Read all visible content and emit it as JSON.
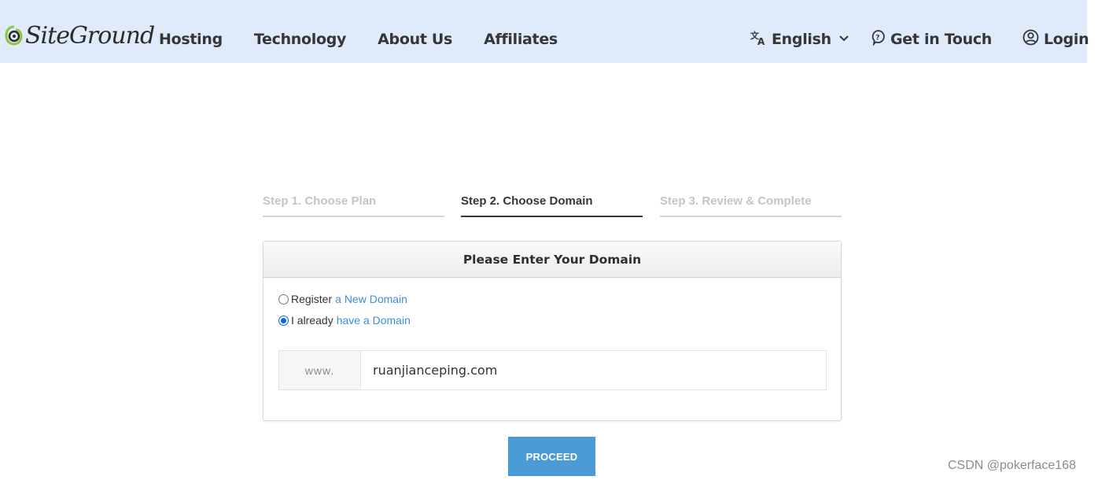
{
  "header": {
    "logo_text": "SiteGround",
    "nav": [
      "Hosting",
      "Technology",
      "About Us",
      "Affiliates"
    ],
    "language": "English",
    "contact": "Get in Touch",
    "login": "Login"
  },
  "steps": [
    {
      "label": "Step 1. Choose Plan",
      "state": "inactive"
    },
    {
      "label": "Step 2. Choose Domain",
      "state": "active"
    },
    {
      "label": "Step 3. Review & Complete",
      "state": "inactive"
    }
  ],
  "card": {
    "title": "Please Enter Your Domain",
    "options": [
      {
        "prefix": "Register",
        "link": "a New Domain",
        "checked": false
      },
      {
        "prefix": "I already",
        "link": "have a Domain",
        "checked": true
      }
    ],
    "domain_prefix": "www.",
    "domain_value": "ruanjianceping.com"
  },
  "proceed_label": "PROCEED",
  "watermark": "CSDN @pokerface168",
  "colors": {
    "header_bg": "#dfeafb",
    "logo_green": "#8dc63f",
    "link": "#3d8fd8",
    "button": "#4b9bd6"
  }
}
